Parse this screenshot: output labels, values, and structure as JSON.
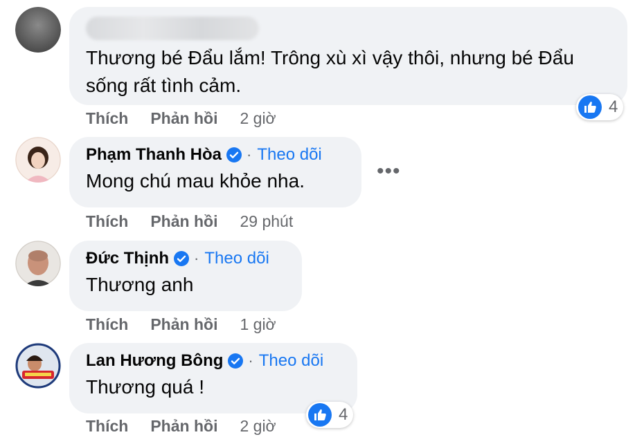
{
  "comments": [
    {
      "text": "Thương bé Đẩu lắm! Trông xù xì vậy thôi, nhưng bé Đẩu sống rất tình cảm.",
      "actions": {
        "like": "Thích",
        "reply": "Phản hồi",
        "time": "2 giờ"
      },
      "reactions": "4"
    },
    {
      "name": "Phạm Thanh Hòa",
      "separator": "·",
      "follow": "Theo dõi",
      "text": "Mong chú mau khỏe nha.",
      "actions": {
        "like": "Thích",
        "reply": "Phản hồi",
        "time": "29 phút"
      },
      "more": "•••"
    },
    {
      "name": "Đức Thịnh",
      "separator": "·",
      "follow": "Theo dõi",
      "text": "Thương anh",
      "actions": {
        "like": "Thích",
        "reply": "Phản hồi",
        "time": "1 giờ"
      }
    },
    {
      "name": "Lan Hương Bông",
      "separator": "·",
      "follow": "Theo dõi",
      "text": "Thương quá !",
      "actions": {
        "like": "Thích",
        "reply": "Phản hồi",
        "time": "2 giờ"
      },
      "reactions": "4"
    }
  ],
  "colors": {
    "link": "#1877f2",
    "bubble": "#f0f2f5",
    "muted": "#65676b"
  }
}
